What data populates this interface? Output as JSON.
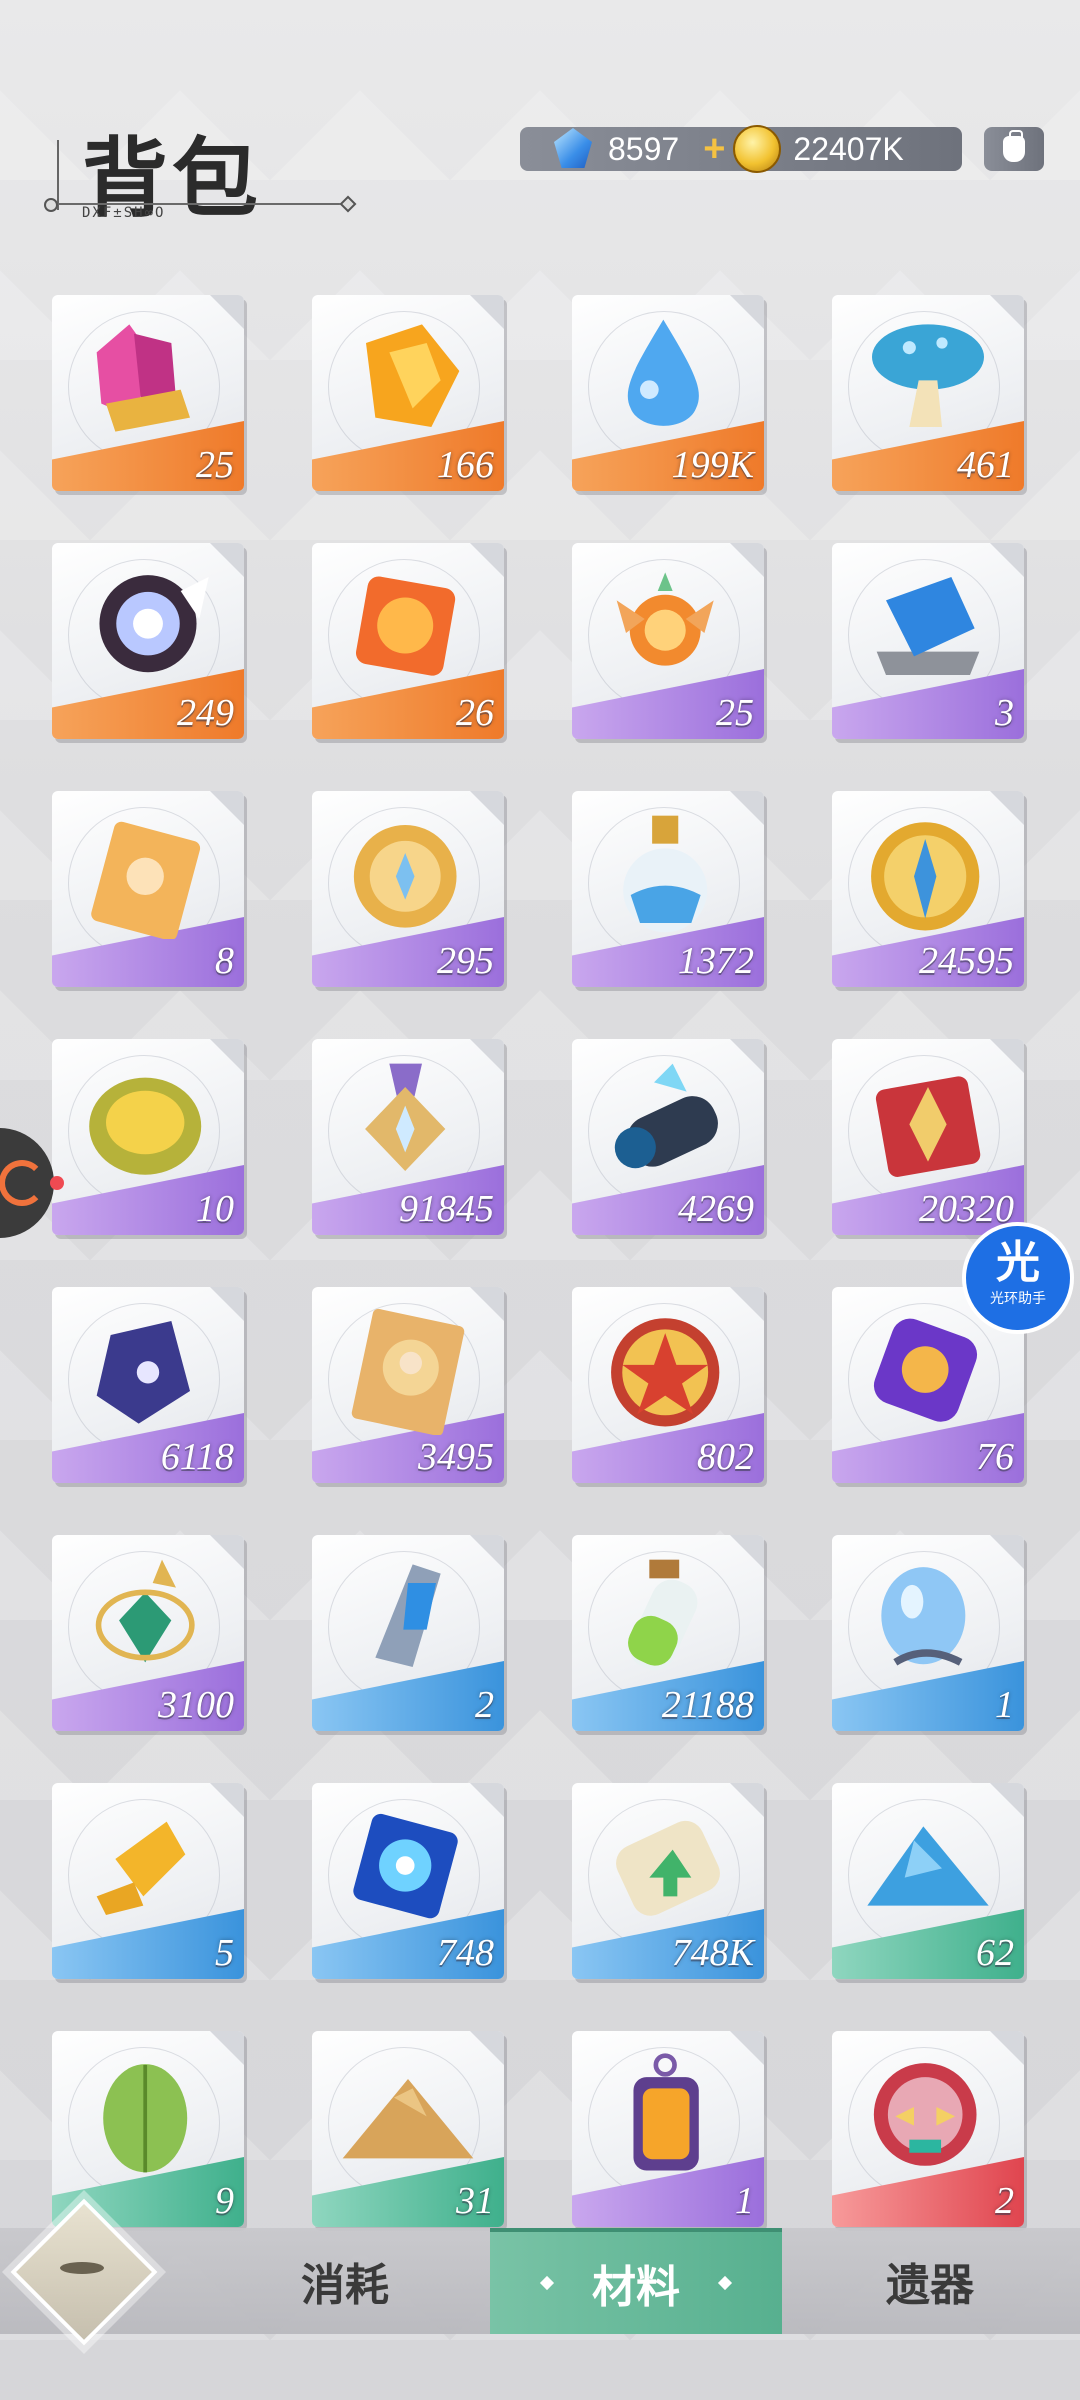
{
  "header": {
    "title": "背包",
    "subtitle": "DXF±SH∞O",
    "diamonds": "8597",
    "plus": "+",
    "coins": "22407K"
  },
  "items": [
    {
      "name": "crystal-pink",
      "count": "25",
      "band": "orange"
    },
    {
      "name": "amber-shard",
      "count": "166",
      "band": "orange"
    },
    {
      "name": "water-drop",
      "count": "199K",
      "band": "orange"
    },
    {
      "name": "blue-mushroom",
      "count": "461",
      "band": "orange"
    },
    {
      "name": "dark-orb",
      "count": "249",
      "band": "orange"
    },
    {
      "name": "fire-crystal",
      "count": "26",
      "band": "orange"
    },
    {
      "name": "phoenix-orb",
      "count": "25",
      "band": "purple"
    },
    {
      "name": "blue-ore",
      "count": "3",
      "band": "purple"
    },
    {
      "name": "gold-ticket",
      "count": "8",
      "band": "purple"
    },
    {
      "name": "gold-medal-coin",
      "count": "295",
      "band": "purple"
    },
    {
      "name": "blue-potion",
      "count": "1372",
      "band": "purple"
    },
    {
      "name": "sword-coin",
      "count": "24595",
      "band": "purple"
    },
    {
      "name": "durian",
      "count": "10",
      "band": "purple"
    },
    {
      "name": "star-medal",
      "count": "91845",
      "band": "purple"
    },
    {
      "name": "wood-log",
      "count": "4269",
      "band": "purple"
    },
    {
      "name": "red-box",
      "count": "20320",
      "band": "purple"
    },
    {
      "name": "void-stone",
      "count": "6118",
      "band": "purple"
    },
    {
      "name": "hero-card",
      "count": "3495",
      "band": "purple"
    },
    {
      "name": "star-coin",
      "count": "802",
      "band": "purple"
    },
    {
      "name": "purple-relic",
      "count": "76",
      "band": "purple"
    },
    {
      "name": "emerald-charm",
      "count": "3100",
      "band": "purple"
    },
    {
      "name": "blue-chunk",
      "count": "2",
      "band": "blue"
    },
    {
      "name": "green-vial",
      "count": "21188",
      "band": "blue"
    },
    {
      "name": "bubble-fruit",
      "count": "1",
      "band": "blue"
    },
    {
      "name": "gold-nugget",
      "count": "5",
      "band": "blue"
    },
    {
      "name": "blue-star-gem",
      "count": "748",
      "band": "blue"
    },
    {
      "name": "scroll",
      "count": "748K",
      "band": "blue"
    },
    {
      "name": "blue-sand",
      "count": "62",
      "band": "green"
    },
    {
      "name": "green-seed",
      "count": "9",
      "band": "green"
    },
    {
      "name": "sand-pile",
      "count": "31",
      "band": "green"
    },
    {
      "name": "lantern",
      "count": "1",
      "band": "purple"
    },
    {
      "name": "demon-mask",
      "count": "2",
      "band": "red"
    }
  ],
  "nav": {
    "tab_consume": "消耗",
    "tab_material": "材料",
    "tab_relic": "遗器"
  },
  "assistant": {
    "glyph": "光",
    "label": "光环助手"
  }
}
